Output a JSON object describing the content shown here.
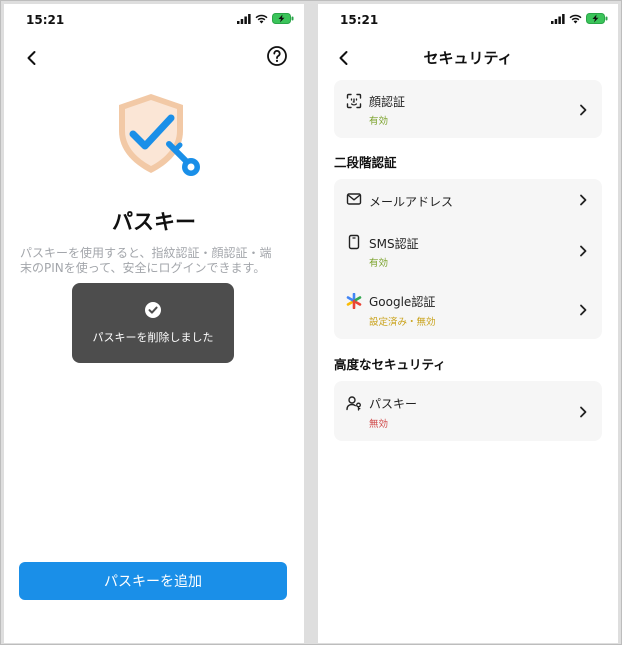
{
  "colors": {
    "primary": "#1a8fe8",
    "status_active": "#7aa22a",
    "status_configured": "#c9a21a",
    "status_disabled": "#d04a4a",
    "text_muted": "#a3a6ab",
    "toast_bg": "#4d4d4d"
  },
  "left_screen": {
    "status_time": "15:21",
    "title": "パスキー",
    "description": "パスキーを使用すると、指紋認証・顔認証・端末のPINを使って、安全にログインできます。",
    "toast": "パスキーを削除しました",
    "add_button": "パスキーを追加",
    "icons": [
      "back-chevron-icon",
      "help-icon",
      "shield-key-icon",
      "check-circle-icon"
    ]
  },
  "right_screen": {
    "status_time": "15:21",
    "title": "セキュリティ",
    "face_auth": {
      "label": "顔認証",
      "status": "有効"
    },
    "two_factor_title": "二段階認証",
    "two_factor": [
      {
        "label": "メールアドレス",
        "status": ""
      },
      {
        "label": "SMS認証",
        "status": "有効"
      },
      {
        "label": "Google認証",
        "status": "設定済み・無効"
      }
    ],
    "advanced_title": "高度なセキュリティ",
    "passkey": {
      "label": "パスキー",
      "status": "無効"
    }
  }
}
